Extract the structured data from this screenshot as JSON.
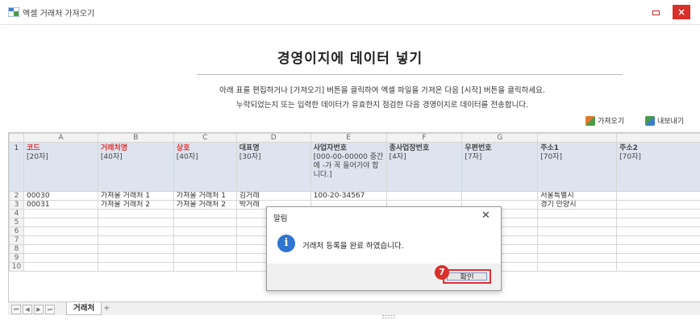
{
  "window": {
    "title": "엑셀 거래처 가져오기"
  },
  "heading": "경영이지에 데이터 넣기",
  "description": [
    "아래 표를 편집하거나 [가져오기] 버튼을 클릭하여 엑셀 파일을 가져온 다음 [시작] 버튼을 클릭하세요.",
    "누락되었는지 또는 입력한 데이터가 유효한지 점검한 다음 경영이지로 데이터를 전송합니다."
  ],
  "toolbar": {
    "import_label": "가져오기",
    "export_label": "내보내기"
  },
  "sheet": {
    "col_letters": [
      "A",
      "B",
      "C",
      "D",
      "E",
      "F",
      "G",
      "",
      ""
    ],
    "headers": [
      {
        "title": "코드",
        "sub": "[20자]",
        "required": true
      },
      {
        "title": "거래처명",
        "sub": "[40자]",
        "required": true
      },
      {
        "title": "상호",
        "sub": "[40자]",
        "required": true
      },
      {
        "title": "대표명",
        "sub": "[30자]",
        "required": false
      },
      {
        "title": "사업자번호",
        "sub": "[000-00-00000 중간에 -가 꼭 들어가야 합니다.]",
        "required": false
      },
      {
        "title": "종사업장번호",
        "sub": "[4자]",
        "required": false
      },
      {
        "title": "우편번호",
        "sub": "[7자]",
        "required": false
      },
      {
        "title": "주소1",
        "sub": "[70자]",
        "required": false
      },
      {
        "title": "주소2",
        "sub": "[70자]",
        "required": false
      }
    ],
    "header_row_num": "1",
    "rows": [
      {
        "num": "2",
        "cells": [
          "00030",
          "가져올 거래처 1",
          "가져올 거래처 1",
          "김거래",
          "100-20-34567",
          "",
          "",
          "서울특별시",
          ""
        ]
      },
      {
        "num": "3",
        "cells": [
          "00031",
          "가져올 거래처 2",
          "가져올 거래처 2",
          "박거래",
          "",
          "",
          "",
          "경기 안양시",
          ""
        ]
      },
      {
        "num": "4",
        "cells": [
          "",
          "",
          "",
          "",
          "",
          "",
          "",
          "",
          ""
        ]
      },
      {
        "num": "5",
        "cells": [
          "",
          "",
          "",
          "",
          "",
          "",
          "",
          "",
          ""
        ]
      },
      {
        "num": "6",
        "cells": [
          "",
          "",
          "",
          "",
          "",
          "",
          "",
          "",
          ""
        ]
      },
      {
        "num": "7",
        "cells": [
          "",
          "",
          "",
          "",
          "",
          "",
          "",
          "",
          ""
        ]
      },
      {
        "num": "8",
        "cells": [
          "",
          "",
          "",
          "",
          "",
          "",
          "",
          "",
          ""
        ]
      },
      {
        "num": "9",
        "cells": [
          "",
          "",
          "",
          "",
          "",
          "",
          "",
          "",
          ""
        ]
      },
      {
        "num": "10",
        "cells": [
          "",
          "",
          "",
          "",
          "",
          "",
          "",
          "",
          ""
        ]
      }
    ],
    "tab_label": "거래처",
    "add_tab": "+"
  },
  "dialog": {
    "title": "알림",
    "message": "거래처 등록을 완료 하였습니다.",
    "ok_label": "확인",
    "step_number": "7"
  },
  "colors": {
    "required": "#dd3333",
    "header_bg": "#dde4ef",
    "accent": "#d9302a",
    "info": "#2f74d0"
  }
}
